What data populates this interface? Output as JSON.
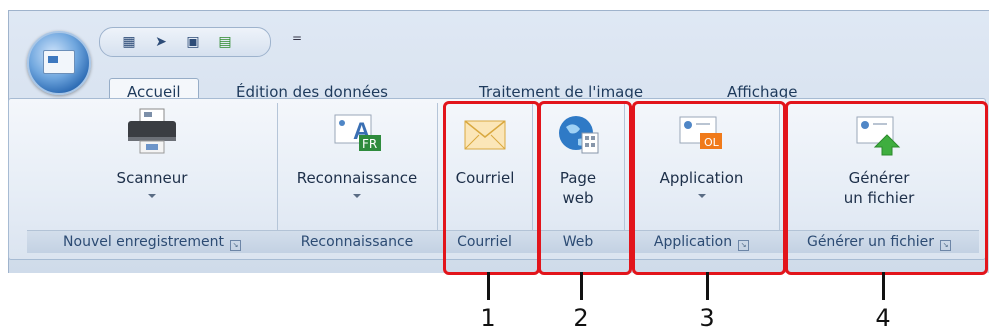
{
  "tabs": [
    "Accueil",
    "Édition des données",
    "Traitement de l'image",
    "Affichage"
  ],
  "qat": {
    "icons": [
      "document-icon",
      "pointer-icon",
      "printer-icon",
      "export-icon"
    ],
    "more": "="
  },
  "groups": {
    "nouvel_enregistrement": {
      "label": "Nouvel enregistrement",
      "button": "Scanneur"
    },
    "reconnaissance": {
      "label": "Reconnaissance",
      "button": "Reconnaissance"
    },
    "courriel": {
      "label": "Courriel",
      "button": "Courriel"
    },
    "web": {
      "label": "Web",
      "button_line1": "Page",
      "button_line2": "web"
    },
    "application": {
      "label": "Application",
      "button": "Application"
    },
    "generer": {
      "label": "Générer un fichier",
      "button_line1": "Générer",
      "button_line2": "un fichier"
    }
  },
  "icon_badges": {
    "fr": "FR",
    "ol": "OL"
  },
  "callouts": [
    "1",
    "2",
    "3",
    "4"
  ],
  "colors": {
    "highlight": "#e2141b",
    "ribbon_text": "#2c4b73"
  }
}
